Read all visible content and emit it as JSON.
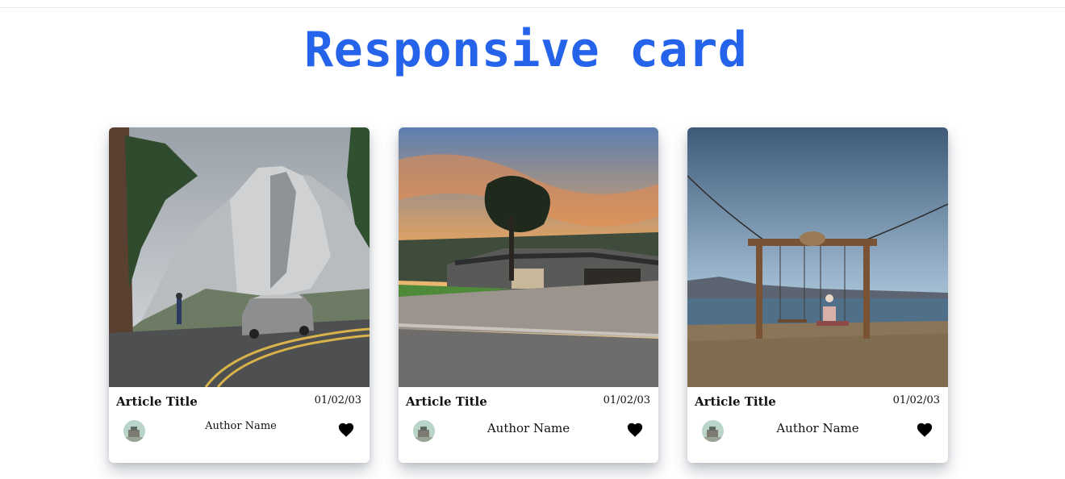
{
  "page": {
    "title": "Responsive card"
  },
  "cards": [
    {
      "title": "Article Title",
      "date": "01/02/03",
      "author": "Author Name",
      "image": "half-dome-road"
    },
    {
      "title": "Article Title",
      "date": "01/02/03",
      "author": "Author Name",
      "image": "house-sunset"
    },
    {
      "title": "Article Title",
      "date": "01/02/03",
      "author": "Author Name",
      "image": "lake-swing"
    }
  ],
  "colors": {
    "title": "#2563eb",
    "heart": "#000000"
  },
  "icons": {
    "like": "heart-icon",
    "avatar": "avatar"
  }
}
